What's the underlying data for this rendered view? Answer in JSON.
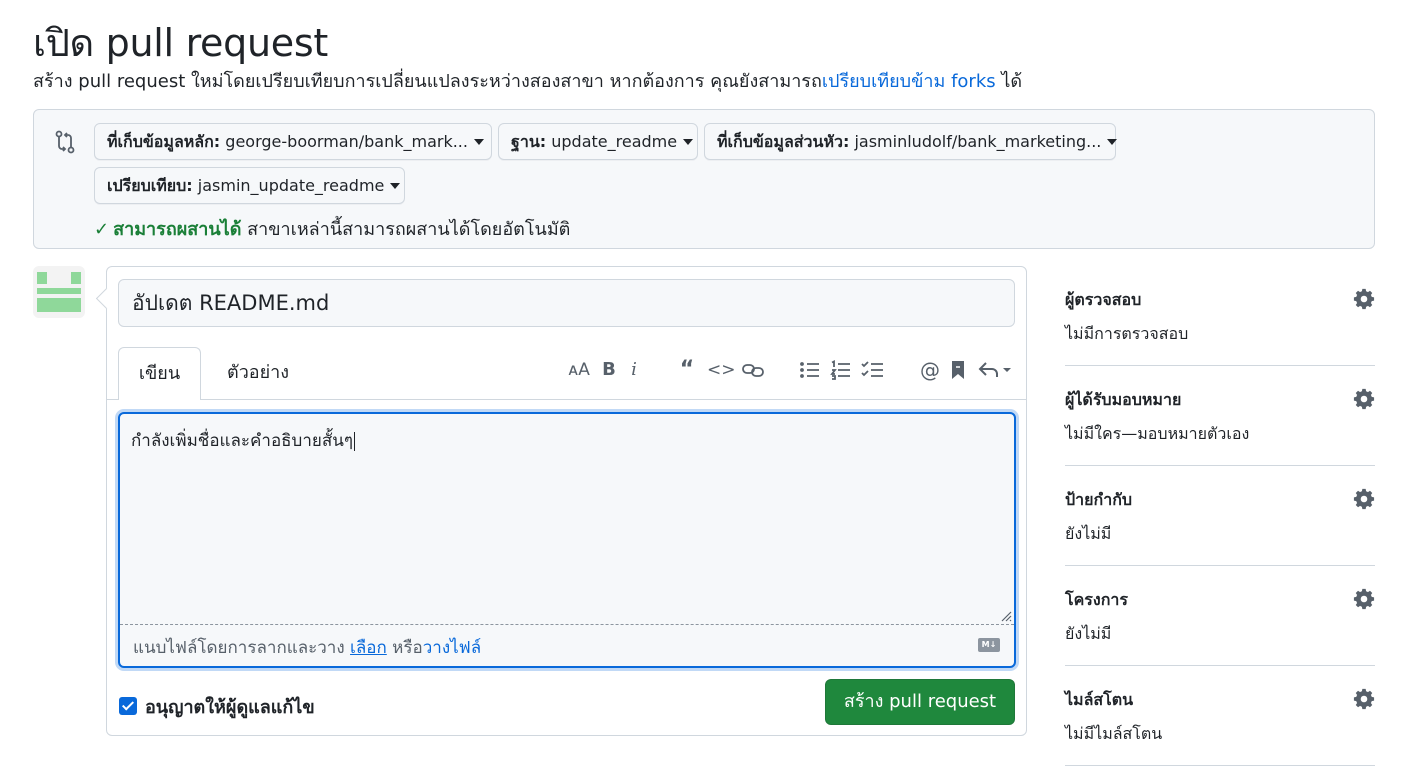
{
  "header": {
    "title": "เปิด pull request",
    "subtitle_text": "สร้าง pull request ใหม่โดยเปรียบเทียบการเปลี่ยนแปลงระหว่างสองสาขา หากต้องการ คุณยังสามารถ",
    "subtitle_link": "เปรียบเทียบข้าม forks",
    "subtitle_end": " ได้"
  },
  "compare": {
    "base_repo_label": "ที่เก็บข้อมูลหลัก:",
    "base_repo_value": "george-boorman/bank_mark...",
    "base_label": "ฐาน:",
    "base_value": "update_readme",
    "head_repo_label": "ที่เก็บข้อมูลส่วนหัว:",
    "head_repo_value": "jasminludolf/bank_marketing...",
    "compare_label": "เปรียบเทียบ:",
    "compare_value": "jasmin_update_readme",
    "merge_status": "สามารถผสานได้",
    "merge_message": "สาขาเหล่านี้สามารถผสานได้โดยอัตโนมัติ"
  },
  "form": {
    "title_value": "อัปเดต README.md",
    "tab_write": "เขียน",
    "tab_preview": "ตัวอย่าง",
    "body_value": "กำลังเพิ่มชื่อและคำอธิบายสั้นๆ",
    "attach_text": "แนบไฟล์โดยการลากและวาง ",
    "attach_select": "เลือก",
    "attach_or": " หรือ",
    "attach_paste": "วางไฟล์",
    "allow_edits_label": "อนุญาตให้ผู้ดูแลแก้ไข",
    "submit_label": "สร้าง pull request"
  },
  "toolbar_icons": [
    "text-size-icon",
    "bold-icon",
    "italic-icon",
    "quote-icon",
    "code-icon",
    "link-icon",
    "unordered-list-icon",
    "ordered-list-icon",
    "task-list-icon",
    "mention-icon",
    "reference-icon",
    "reply-icon"
  ],
  "sidebar": {
    "reviewers_title": "ผู้ตรวจสอบ",
    "reviewers_value": "ไม่มีการตรวจสอบ",
    "assignees_title": "ผู้ได้รับมอบหมาย",
    "assignees_value": "ไม่มีใคร—มอบหมายตัวเอง",
    "labels_title": "ป้ายกำกับ",
    "labels_value": "ยังไม่มี",
    "projects_title": "โครงการ",
    "projects_value": "ยังไม่มี",
    "milestone_title": "ไมล์สโตน",
    "milestone_value": "ไม่มีไมล์สโตน"
  },
  "colors": {
    "accent": "#0969da",
    "success": "#1a7f37",
    "button_green": "#1f883d"
  }
}
